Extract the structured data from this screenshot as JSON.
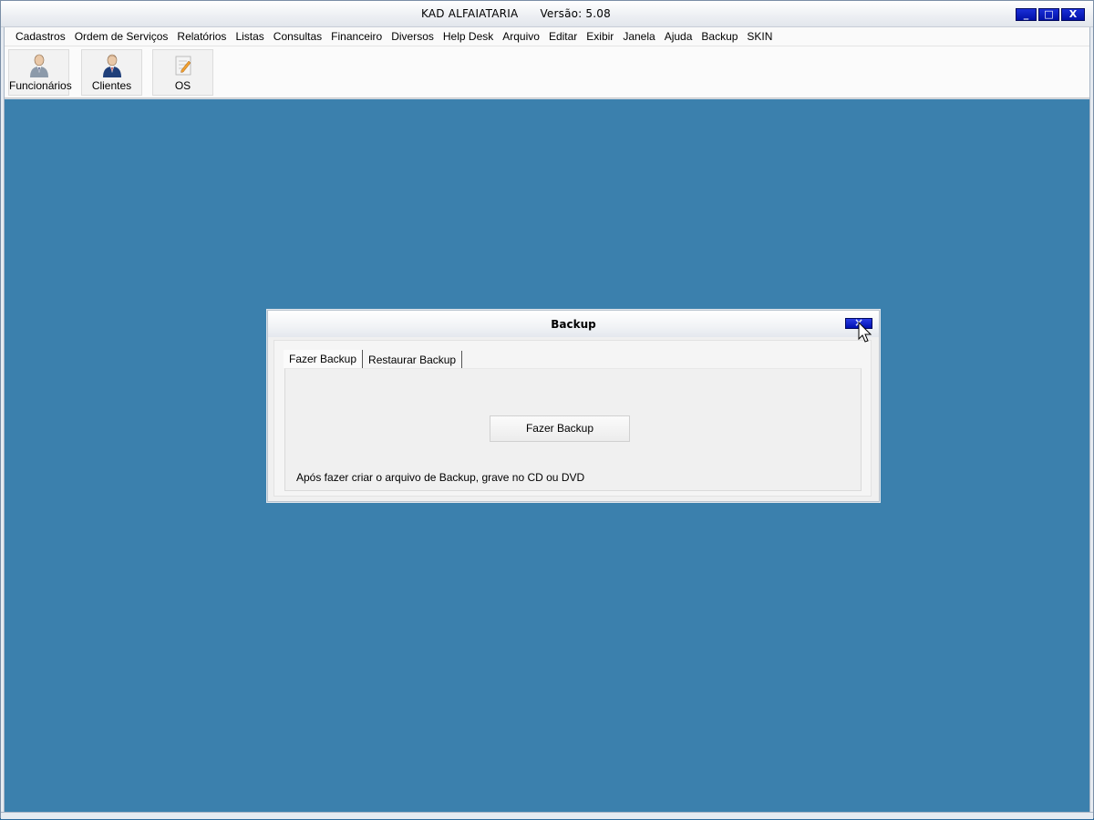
{
  "window": {
    "title": "KAD ALFAIATARIA      Versão: 5.08",
    "controls": {
      "minimize": "_",
      "maximize": "□",
      "close": "X"
    }
  },
  "menu": {
    "items": [
      "Cadastros",
      "Ordem de Serviços",
      "Relatórios",
      "Listas",
      "Consultas",
      "Financeiro",
      "Diversos",
      "Help Desk",
      "Arquivo",
      "Editar",
      "Exibir",
      "Janela",
      "Ajuda",
      "Backup",
      "SKIN"
    ]
  },
  "toolbar": {
    "buttons": [
      {
        "label": "Funcionários",
        "icon": "person-icon"
      },
      {
        "label": "Clientes",
        "icon": "businessman-icon"
      },
      {
        "label": "OS",
        "icon": "document-edit-icon"
      }
    ]
  },
  "dialog": {
    "title": "Backup",
    "tabs": [
      "Fazer Backup",
      "Restaurar Backup"
    ],
    "active_tab": "Fazer Backup",
    "action_button": "Fazer Backup",
    "info": "Após fazer criar o arquivo de Backup, grave no CD ou DVD"
  },
  "colors": {
    "workspace": "#3b80ad",
    "window_buttons": "#0010a8"
  }
}
